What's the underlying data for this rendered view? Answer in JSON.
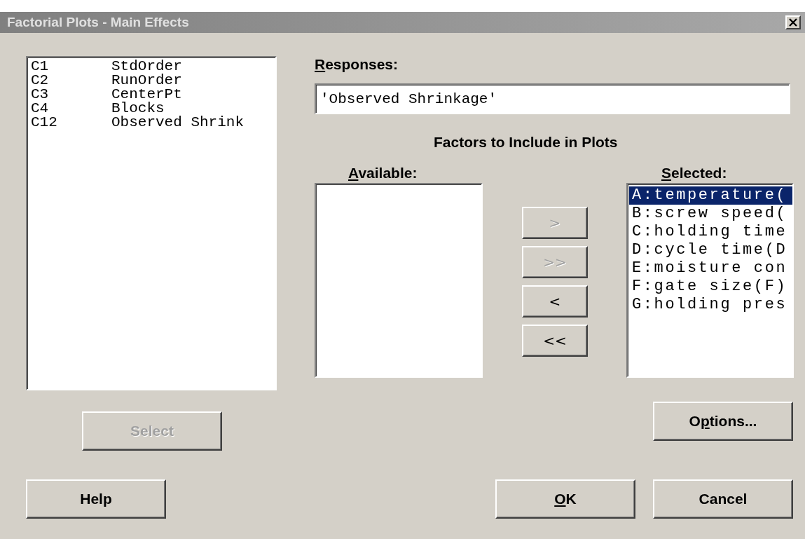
{
  "window": {
    "title": "Factorial Plots - Main Effects"
  },
  "columns_list": [
    {
      "id": "C1",
      "name": "StdOrder"
    },
    {
      "id": "C2",
      "name": "RunOrder"
    },
    {
      "id": "C3",
      "name": "CenterPt"
    },
    {
      "id": "C4",
      "name": "Blocks"
    },
    {
      "id": "C12",
      "name": "Observed Shrink"
    }
  ],
  "responses": {
    "label": [
      {
        "text": "R",
        "underlined": true
      },
      {
        "text": "esponses:",
        "underlined": false
      }
    ],
    "value": "'Observed Shrinkage'"
  },
  "factors": {
    "heading": "Factors to Include in Plots",
    "available": {
      "label": [
        {
          "text": "A",
          "underlined": true
        },
        {
          "text": "vailable:",
          "underlined": false
        }
      ]
    },
    "selected": {
      "label": [
        {
          "text": "S",
          "underlined": true
        },
        {
          "text": "elected:",
          "underlined": false
        }
      ],
      "items": [
        {
          "text": "A:temperature(",
          "selected": true
        },
        {
          "text": "B:screw speed(",
          "selected": false
        },
        {
          "text": "C:holding time",
          "selected": false
        },
        {
          "text": "D:cycle time(D",
          "selected": false
        },
        {
          "text": "E:moisture con",
          "selected": false
        },
        {
          "text": "F:gate size(F)",
          "selected": false
        },
        {
          "text": "G:holding pres",
          "selected": false
        }
      ]
    },
    "move_buttons": [
      {
        "label": ">",
        "disabled": true
      },
      {
        "label": ">>",
        "disabled": true
      },
      {
        "label": "<",
        "disabled": false
      },
      {
        "label": "<<",
        "disabled": false
      }
    ]
  },
  "select_button": {
    "label": "Select",
    "disabled": true
  },
  "options_button": {
    "label": [
      {
        "text": "O",
        "underlined": false
      },
      {
        "text": "p",
        "underlined": true
      },
      {
        "text": "tions...",
        "underlined": false
      }
    ],
    "disabled": false
  },
  "help_button": {
    "label": "Help",
    "disabled": false
  },
  "ok_button": {
    "label": [
      {
        "text": "O",
        "underlined": true
      },
      {
        "text": "K",
        "underlined": false
      }
    ],
    "disabled": false
  },
  "cancel_button": {
    "label": "Cancel",
    "disabled": false
  }
}
